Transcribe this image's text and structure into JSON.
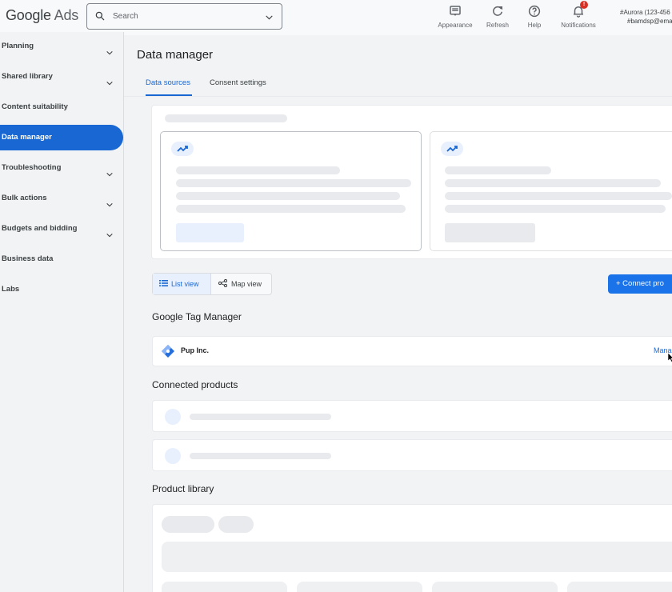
{
  "app": {
    "logo_google": "Google",
    "logo_ads": "Ads"
  },
  "search": {
    "placeholder": "Search"
  },
  "toolbar": {
    "appearance": "Appearance",
    "refresh": "Refresh",
    "help": "Help",
    "notifications": "Notifications",
    "notification_count": "!"
  },
  "account": {
    "line1": "#Aurora (123-456",
    "line2": "#bamdsp@ema"
  },
  "sidebar": {
    "items": [
      {
        "label": "Planning",
        "expandable": true
      },
      {
        "label": "Shared library",
        "expandable": true
      },
      {
        "label": "Content suitability",
        "expandable": false
      },
      {
        "label": "Data manager",
        "expandable": false,
        "active": true
      },
      {
        "label": "Troubleshooting",
        "expandable": true
      },
      {
        "label": "Bulk actions",
        "expandable": true
      },
      {
        "label": "Budgets and bidding",
        "expandable": true
      },
      {
        "label": "Business data",
        "expandable": false
      },
      {
        "label": "Labs",
        "expandable": false
      }
    ]
  },
  "page": {
    "title": "Data manager",
    "tabs": [
      {
        "label": "Data sources",
        "active": true
      },
      {
        "label": "Consent settings"
      }
    ]
  },
  "views": {
    "list": "List view",
    "map": "Map view"
  },
  "connect_button": "+  Connect pro",
  "sections": {
    "gtm": {
      "title": "Google Tag Manager",
      "account_name": "Pup Inc.",
      "manage_link": "Mana"
    },
    "connected": {
      "title": "Connected products"
    },
    "library": {
      "title": "Product library"
    }
  },
  "colors": {
    "accent": "#1967d2",
    "button": "#1a73e8",
    "badge": "#d93025"
  }
}
